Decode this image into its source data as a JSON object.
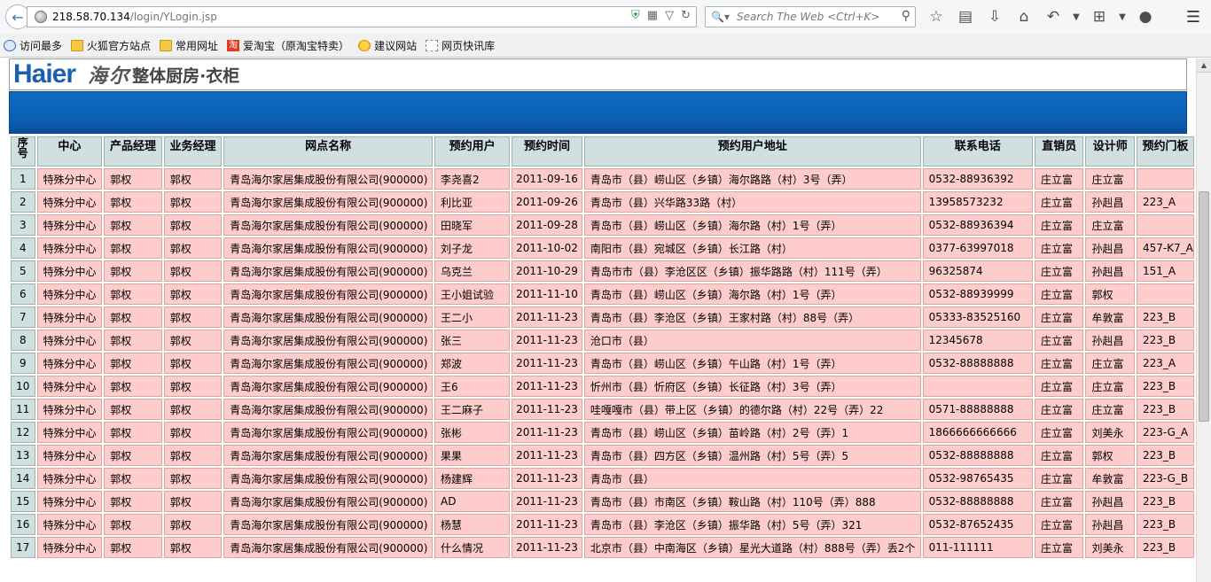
{
  "browser": {
    "url_host": "218.58.70.134",
    "url_path": "/login/YLogin.jsp",
    "search_placeholder": "Search The Web <Ctrl+K>"
  },
  "bookmarks": [
    {
      "label": "访问最多",
      "icon": "most-visited-icon"
    },
    {
      "label": "火狐官方站点",
      "icon": "folder-icon"
    },
    {
      "label": "常用网址",
      "icon": "folder-icon"
    },
    {
      "label": "爱淘宝（原淘宝特卖）",
      "icon": "taobao-icon"
    },
    {
      "label": "建议网站",
      "icon": "bulb-icon"
    },
    {
      "label": "网页快讯库",
      "icon": "web-slice-icon"
    }
  ],
  "header": {
    "logo_en": "Haier",
    "logo_cn": "海尔",
    "subtitle": "整体厨房·衣柜"
  },
  "table": {
    "columns": [
      "序号",
      "中心",
      "产品经理",
      "业务经理",
      "网点名称",
      "预约用户",
      "预约时间",
      "预约用户地址",
      "联系电话",
      "直销员",
      "设计师",
      "预约门板"
    ],
    "rows": [
      [
        "1",
        "特殊分中心",
        "郭权",
        "郭权",
        "青岛海尔家居集成股份有限公司(900000)",
        "李尧喜2",
        "2011-09-16",
        "青岛市（县）崂山区（乡镇）海尔路路（村）3号（弄）",
        "0532-88936392",
        "庄立富",
        "庄立富",
        ""
      ],
      [
        "2",
        "特殊分中心",
        "郭权",
        "郭权",
        "青岛海尔家居集成股份有限公司(900000)",
        "利比亚",
        "2011-09-26",
        "青岛市（县）兴华路33路（村）",
        "13958573232",
        "庄立富",
        "孙赳昌",
        "223_A"
      ],
      [
        "3",
        "特殊分中心",
        "郭权",
        "郭权",
        "青岛海尔家居集成股份有限公司(900000)",
        "田晓军",
        "2011-09-28",
        "青岛市（县）崂山区（乡镇）海尔路（村）1号（弄）",
        "0532-88936394",
        "庄立富",
        "庄立富",
        ""
      ],
      [
        "4",
        "特殊分中心",
        "郭权",
        "郭权",
        "青岛海尔家居集成股份有限公司(900000)",
        "刘子龙",
        "2011-10-02",
        "南阳市（县）宛城区（乡镇）长江路（村）",
        "0377-63997018",
        "庄立富",
        "孙赳昌",
        "457-K7_A"
      ],
      [
        "5",
        "特殊分中心",
        "郭权",
        "郭权",
        "青岛海尔家居集成股份有限公司(900000)",
        "乌克兰",
        "2011-10-29",
        "青岛市市（县）李沧区区（乡镇）振华路路（村）111号（弄）",
        "96325874",
        "庄立富",
        "孙赳昌",
        "151_A"
      ],
      [
        "6",
        "特殊分中心",
        "郭权",
        "郭权",
        "青岛海尔家居集成股份有限公司(900000)",
        "王小姐试验",
        "2011-11-10",
        "青岛市（县）崂山区（乡镇）海尔路（村）1号（弄）",
        "0532-88939999",
        "庄立富",
        "郭权",
        ""
      ],
      [
        "7",
        "特殊分中心",
        "郭权",
        "郭权",
        "青岛海尔家居集成股份有限公司(900000)",
        "王二小",
        "2011-11-23",
        "青岛市（县）李沧区（乡镇）王家村路（村）88号（弄）",
        "05333-83525160",
        "庄立富",
        "牟敦富",
        "223_B"
      ],
      [
        "8",
        "特殊分中心",
        "郭权",
        "郭权",
        "青岛海尔家居集成股份有限公司(900000)",
        "张三",
        "2011-11-23",
        "沧口市（县）",
        "12345678",
        "庄立富",
        "孙赳昌",
        "223_B"
      ],
      [
        "9",
        "特殊分中心",
        "郭权",
        "郭权",
        "青岛海尔家居集成股份有限公司(900000)",
        "郑波",
        "2011-11-23",
        "青岛市（县）崂山区（乡镇）午山路（村）1号（弄）",
        "0532-88888888",
        "庄立富",
        "庄立富",
        "223_A"
      ],
      [
        "10",
        "特殊分中心",
        "郭权",
        "郭权",
        "青岛海尔家居集成股份有限公司(900000)",
        "王6",
        "2011-11-23",
        "忻州市（县）忻府区（乡镇）长征路（村）3号（弄）",
        "",
        "庄立富",
        "庄立富",
        "223_B"
      ],
      [
        "11",
        "特殊分中心",
        "郭权",
        "郭权",
        "青岛海尔家居集成股份有限公司(900000)",
        "王二麻子",
        "2011-11-23",
        "哇嘎嘎市（县）带上区（乡镇）的德尔路（村）22号（弄）22",
        "0571-88888888",
        "庄立富",
        "庄立富",
        "223_B"
      ],
      [
        "12",
        "特殊分中心",
        "郭权",
        "郭权",
        "青岛海尔家居集成股份有限公司(900000)",
        "张彬",
        "2011-11-23",
        "青岛市（县）崂山区（乡镇）苗岭路（村）2号（弄）1",
        "1866666666666",
        "庄立富",
        "刘美永",
        "223-G_A"
      ],
      [
        "13",
        "特殊分中心",
        "郭权",
        "郭权",
        "青岛海尔家居集成股份有限公司(900000)",
        "果果",
        "2011-11-23",
        "青岛市（县）四方区（乡镇）温州路（村）5号（弄）5",
        "0532-88888888",
        "庄立富",
        "郭权",
        "223_B"
      ],
      [
        "14",
        "特殊分中心",
        "郭权",
        "郭权",
        "青岛海尔家居集成股份有限公司(900000)",
        "杨建辉",
        "2011-11-23",
        "青岛市（县）",
        "0532-98765435",
        "庄立富",
        "牟敦富",
        "223-G_B"
      ],
      [
        "15",
        "特殊分中心",
        "郭权",
        "郭权",
        "青岛海尔家居集成股份有限公司(900000)",
        "AD",
        "2011-11-23",
        "青岛市（县）市南区（乡镇）鞍山路（村）110号（弄）888",
        "0532-88888888",
        "庄立富",
        "孙赳昌",
        "223_B"
      ],
      [
        "16",
        "特殊分中心",
        "郭权",
        "郭权",
        "青岛海尔家居集成股份有限公司(900000)",
        "杨慧",
        "2011-11-23",
        "青岛市（县）李沧区（乡镇）振华路（村）5号（弄）321",
        "0532-87652435",
        "庄立富",
        "孙赳昌",
        "223_B"
      ],
      [
        "17",
        "特殊分中心",
        "郭权",
        "郭权",
        "青岛海尔家居集成股份有限公司(900000)",
        "什么情况",
        "2011-11-23",
        "北京市（县）中南海区（乡镇）星光大道路（村）888号（弄）丢2个",
        "011-111111",
        "庄立富",
        "刘美永",
        "223_B"
      ]
    ]
  },
  "colors": {
    "header_cell": "#cfe0df",
    "data_cell": "#ffcccc",
    "brand_blue": "#0a5fb0"
  }
}
